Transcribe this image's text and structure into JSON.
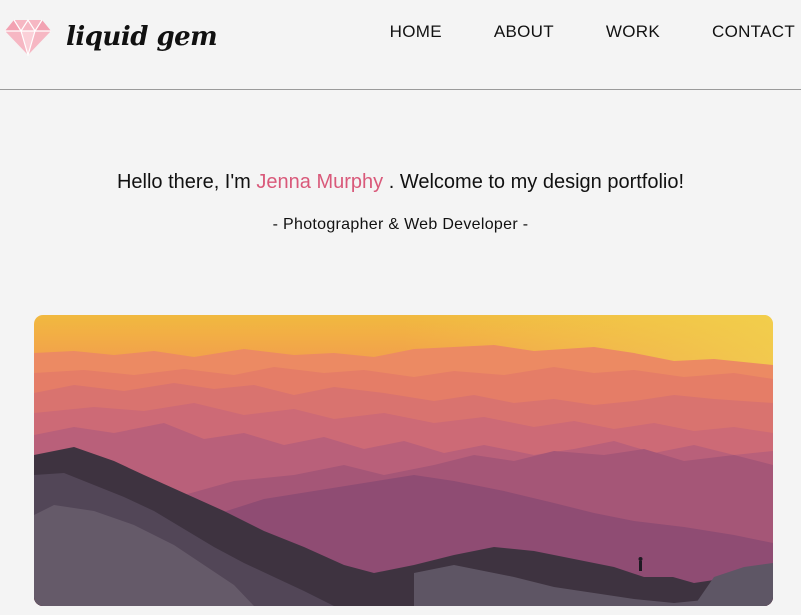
{
  "header": {
    "logo_text": "liquid gem",
    "nav": [
      {
        "label": "HOME"
      },
      {
        "label": "ABOUT"
      },
      {
        "label": "WORK"
      },
      {
        "label": "CONTACT"
      }
    ]
  },
  "intro": {
    "prefix": "Hello there, I'm",
    "name": "Jenna Murphy",
    "suffix": ". Welcome to my design portfolio!"
  },
  "subtitle": "- Photographer & Web Developer -",
  "icons": {
    "logo": "diamond-icon"
  },
  "colors": {
    "accent": "#d9597a",
    "background": "#f4f4f4",
    "gem": "#f2a7b5"
  }
}
